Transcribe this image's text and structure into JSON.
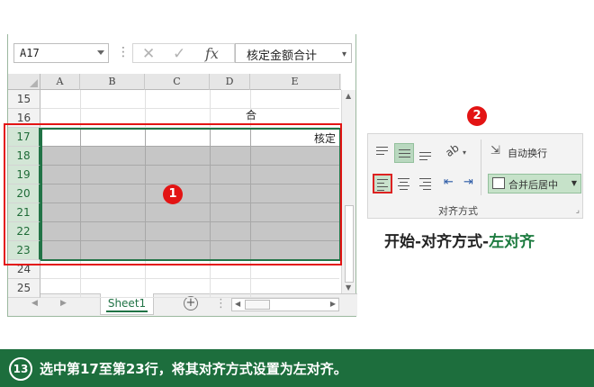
{
  "formula_bar": {
    "name_box": "A17",
    "cancel_glyph": "✕",
    "enter_glyph": "✓",
    "fx_label": "fx",
    "formula_value": "核定金额合计"
  },
  "columns": [
    "A",
    "B",
    "C",
    "D",
    "E"
  ],
  "rows": [
    {
      "num": "15",
      "selected": false,
      "text": ""
    },
    {
      "num": "16",
      "selected": false,
      "text": "合"
    },
    {
      "num": "17",
      "selected": true,
      "text": "核定"
    },
    {
      "num": "18",
      "selected": true,
      "text": ""
    },
    {
      "num": "19",
      "selected": true,
      "text": ""
    },
    {
      "num": "20",
      "selected": true,
      "text": ""
    },
    {
      "num": "21",
      "selected": true,
      "text": ""
    },
    {
      "num": "22",
      "selected": true,
      "text": ""
    },
    {
      "num": "23",
      "selected": true,
      "text": ""
    },
    {
      "num": "24",
      "selected": false,
      "text": ""
    },
    {
      "num": "25",
      "selected": false,
      "text": ""
    }
  ],
  "sheet_tab": "Sheet1",
  "ribbon": {
    "wrap_text": "自动换行",
    "merge_center": "合并后居中",
    "group_label": "对齐方式"
  },
  "markers": {
    "one": "1",
    "two": "2"
  },
  "caption": {
    "part1": "开始-对齐方式-",
    "part2": "左对齐"
  },
  "footer": {
    "step": "13",
    "text": "选中第17至第23行，将其对齐方式设置为左对齐。"
  },
  "colors": {
    "excel_green": "#217346",
    "footer_green": "#1d6e3d",
    "marker_red": "#e31414"
  }
}
